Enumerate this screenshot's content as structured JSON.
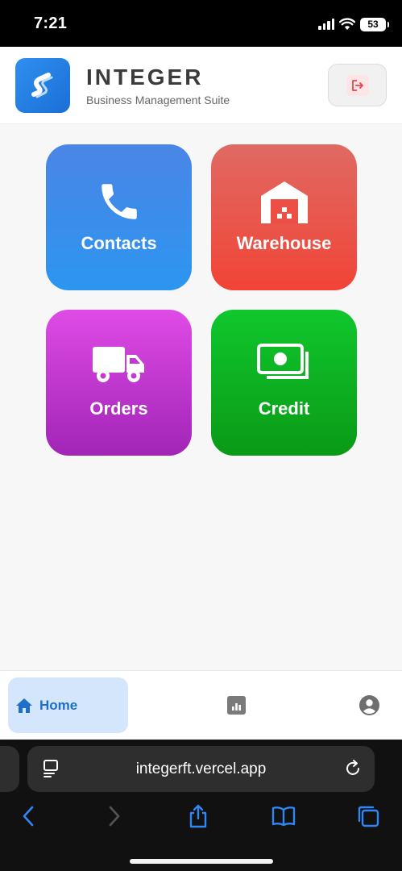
{
  "status_bar": {
    "time": "7:21",
    "battery": "53"
  },
  "header": {
    "title": "INTEGER",
    "subtitle": "Business Management Suite"
  },
  "tiles": [
    {
      "label": "Contacts",
      "icon": "phone-icon"
    },
    {
      "label": "Warehouse",
      "icon": "warehouse-icon"
    },
    {
      "label": "Orders",
      "icon": "truck-icon"
    },
    {
      "label": "Credit",
      "icon": "money-icon"
    }
  ],
  "bottom_nav": {
    "home_label": "Home",
    "items": [
      "home-icon",
      "stats-icon",
      "profile-icon"
    ]
  },
  "browser": {
    "url": "integerft.vercel.app"
  },
  "colors": {
    "contacts": "#2c95f0",
    "warehouse": "#f14436",
    "orders": "#c03ad0",
    "credit": "#0cb020",
    "accent": "#1e6fc9"
  }
}
